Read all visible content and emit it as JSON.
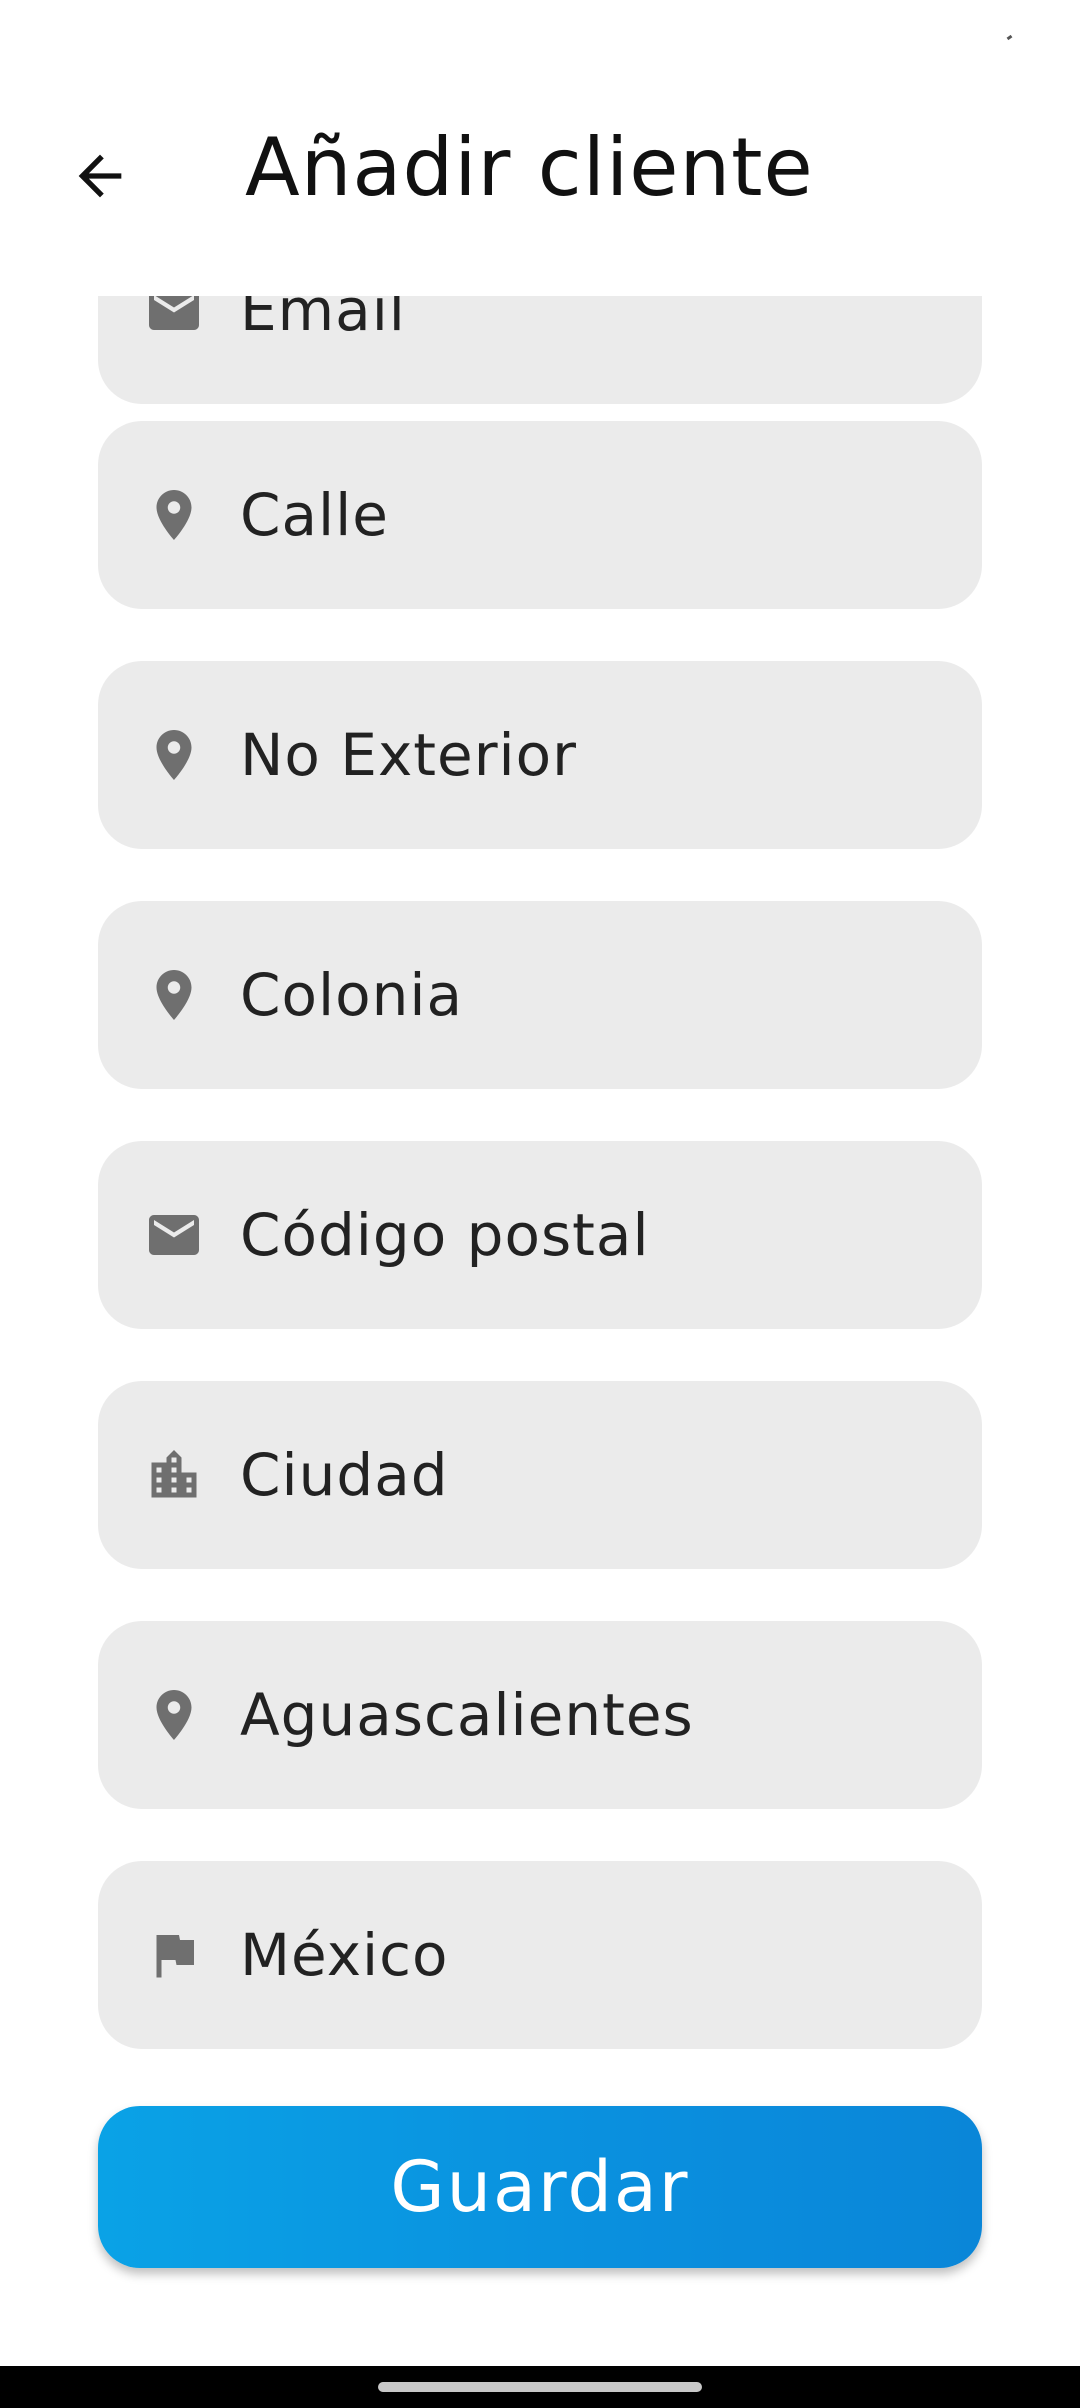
{
  "header": {
    "title": "Añadir cliente",
    "back_icon": "arrow-back-icon"
  },
  "form": {
    "fields": [
      {
        "placeholder": "Email",
        "icon": "mail-icon",
        "partially_visible": true
      },
      {
        "placeholder": "Calle",
        "icon": "location-pin-icon"
      },
      {
        "placeholder": "No Exterior",
        "icon": "location-pin-icon"
      },
      {
        "placeholder": "Colonia",
        "icon": "location-pin-icon"
      },
      {
        "placeholder": "Código postal",
        "icon": "mail-icon"
      },
      {
        "placeholder": "Ciudad",
        "icon": "city-buildings-icon"
      },
      {
        "placeholder": "Aguascalientes",
        "icon": "location-pin-icon"
      },
      {
        "placeholder": "México",
        "icon": "flag-icon"
      }
    ]
  },
  "save_button": {
    "label": "Guardar"
  },
  "colors": {
    "field_background": "#ebebeb",
    "icon": "#6f6f6f",
    "button_gradient_start": "#0aa2e6",
    "button_gradient_end": "#0a86d8",
    "nav_bar": "#000000"
  }
}
